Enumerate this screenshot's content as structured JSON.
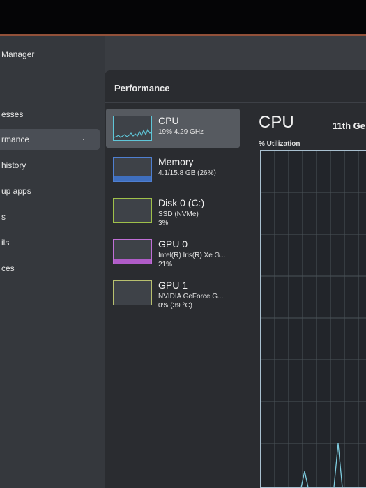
{
  "app": {
    "title_fragment": "Manager"
  },
  "sidebar": {
    "items": [
      {
        "label": "esses"
      },
      {
        "label": "rmance"
      },
      {
        "label": "history"
      },
      {
        "label": "up apps"
      },
      {
        "label": "s"
      },
      {
        "label": "ils"
      },
      {
        "label": "ces"
      }
    ]
  },
  "main": {
    "header": "Performance",
    "devices": [
      {
        "name": "CPU",
        "line1": "19%",
        "line1b": "4.29 GHz",
        "line2": "",
        "accent": "#5fc6d8"
      },
      {
        "name": "Memory",
        "line1": "4.1/15.8 GB (26%)",
        "line2": "",
        "accent": "#4f7fd0"
      },
      {
        "name": "Disk 0 (C:)",
        "line1": "SSD (NVMe)",
        "line2": "3%",
        "accent": "#9fc04a"
      },
      {
        "name": "GPU 0",
        "line1": "Intel(R) Iris(R) Xe G...",
        "line2": "21%",
        "accent": "#c06fd6"
      },
      {
        "name": "GPU 1",
        "line1": "NVIDIA GeForce G...",
        "line2": "0% (39 °C)",
        "accent": "#b8c06f"
      }
    ],
    "detail": {
      "title": "CPU",
      "model": "11th Ge",
      "util_label": "% Utilization"
    }
  }
}
